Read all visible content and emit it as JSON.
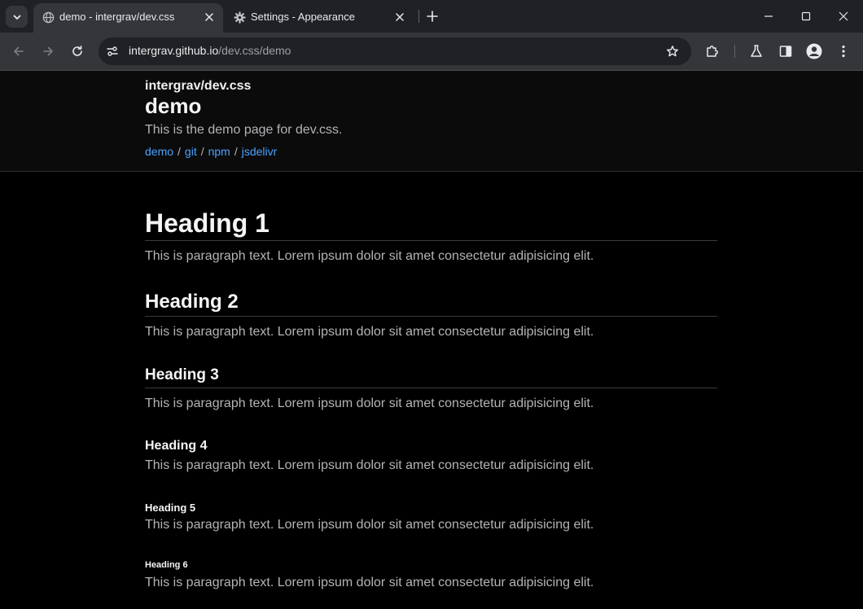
{
  "browser": {
    "tabs": [
      {
        "title": "demo - intergrav/dev.css",
        "icon": "globe-icon",
        "active": true
      },
      {
        "title": "Settings - Appearance",
        "icon": "gear-icon",
        "active": false
      }
    ],
    "url": {
      "host": "intergrav.github.io",
      "path": "/dev.css/demo"
    },
    "colors": {
      "tabstrip": "#202124",
      "toolbar": "#35363a",
      "omnibox": "#202124"
    }
  },
  "site": {
    "name": "intergrav/dev.css",
    "title": "demo",
    "description": "This is the demo page for dev.css.",
    "links": [
      "demo",
      "git",
      "npm",
      "jsdelivr"
    ],
    "separator": "/",
    "link_color": "#4aa3ff"
  },
  "content": {
    "headings": [
      {
        "level": 1,
        "text": "Heading 1",
        "paragraph": "This is paragraph text. Lorem ipsum dolor sit amet consectetur adipisicing elit."
      },
      {
        "level": 2,
        "text": "Heading 2",
        "paragraph": "This is paragraph text. Lorem ipsum dolor sit amet consectetur adipisicing elit."
      },
      {
        "level": 3,
        "text": "Heading 3",
        "paragraph": "This is paragraph text. Lorem ipsum dolor sit amet consectetur adipisicing elit."
      },
      {
        "level": 4,
        "text": "Heading 4",
        "paragraph": "This is paragraph text. Lorem ipsum dolor sit amet consectetur adipisicing elit."
      },
      {
        "level": 5,
        "text": "Heading 5",
        "paragraph": "This is paragraph text. Lorem ipsum dolor sit amet consectetur adipisicing elit."
      },
      {
        "level": 6,
        "text": "Heading 6",
        "paragraph": "This is paragraph text. Lorem ipsum dolor sit amet consectetur adipisicing elit."
      }
    ]
  }
}
